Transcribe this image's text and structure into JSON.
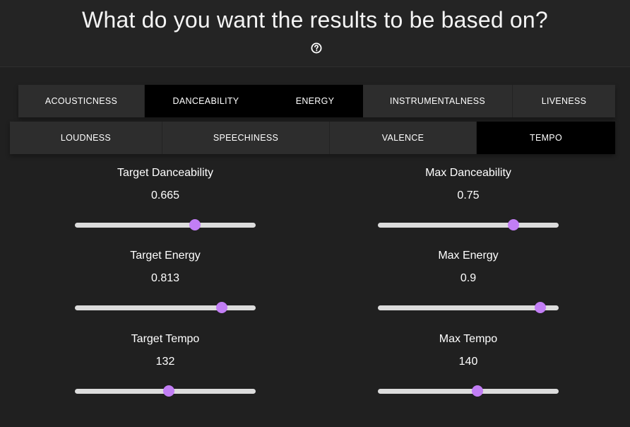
{
  "header": {
    "title": "What do you want the results to be based on?",
    "help_icon": "question-circle-icon"
  },
  "tabs_row1": [
    {
      "label": "ACOUSTICNESS",
      "active": false
    },
    {
      "label": "DANCEABILITY",
      "active": true
    },
    {
      "label": "ENERGY",
      "active": true
    },
    {
      "label": "INSTRUMENTALNESS",
      "active": false
    },
    {
      "label": "LIVENESS",
      "active": false
    }
  ],
  "tabs_row2": [
    {
      "label": "LOUDNESS",
      "active": false
    },
    {
      "label": "SPEECHINESS",
      "active": false
    },
    {
      "label": "VALENCE",
      "active": false
    },
    {
      "label": "TEMPO",
      "active": true
    }
  ],
  "sliders": [
    {
      "label": "Target Danceability",
      "value": "0.665",
      "fraction": 0.665
    },
    {
      "label": "Max Danceability",
      "value": "0.75",
      "fraction": 0.75
    },
    {
      "label": "Target Energy",
      "value": "0.813",
      "fraction": 0.813
    },
    {
      "label": "Max Energy",
      "value": "0.9",
      "fraction": 0.9
    },
    {
      "label": "Target Tempo",
      "value": "132",
      "fraction": 0.52
    },
    {
      "label": "Max Tempo",
      "value": "140",
      "fraction": 0.55
    }
  ],
  "colors": {
    "background": "#202020",
    "tab_inactive": "#2d2d2d",
    "tab_active": "#000000",
    "slider_track": "#dcdcdc",
    "slider_thumb": "#c27ef5"
  }
}
